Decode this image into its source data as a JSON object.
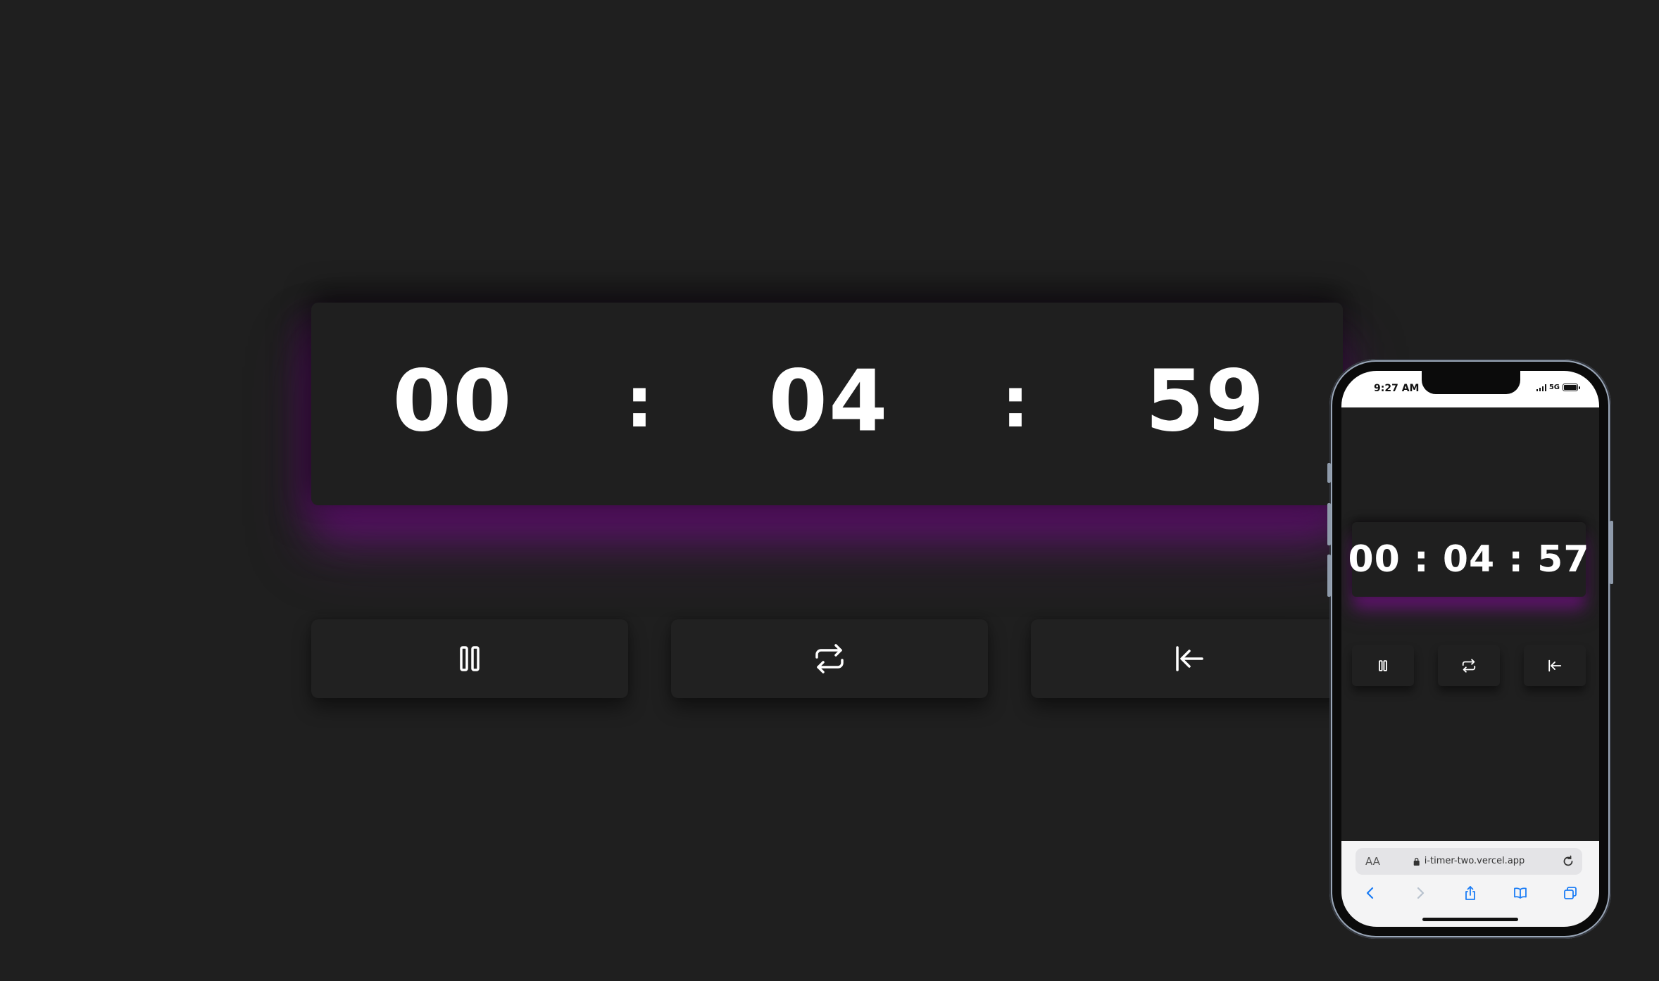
{
  "desktop": {
    "hours": "00",
    "minutes": "04",
    "seconds": "59",
    "separator": ":",
    "buttons": [
      {
        "action": "pause",
        "icon": "pause-icon"
      },
      {
        "action": "repeat",
        "icon": "repeat-icon"
      },
      {
        "action": "reset",
        "icon": "reset-to-start-icon"
      }
    ]
  },
  "mobile": {
    "status_time": "9:27 AM",
    "network": "5G",
    "time_display": "00 : 04 : 57",
    "buttons": [
      {
        "action": "pause",
        "icon": "pause-icon"
      },
      {
        "action": "repeat",
        "icon": "repeat-icon"
      },
      {
        "action": "reset",
        "icon": "reset-to-start-icon"
      }
    ],
    "browser": {
      "text_size_label": "AA",
      "url": "i-timer-two.vercel.app"
    }
  },
  "colors": {
    "background": "#1f1f1f",
    "glow": "#6a1a78",
    "text": "#ffffff",
    "ios_blue": "#1a7cf5"
  }
}
